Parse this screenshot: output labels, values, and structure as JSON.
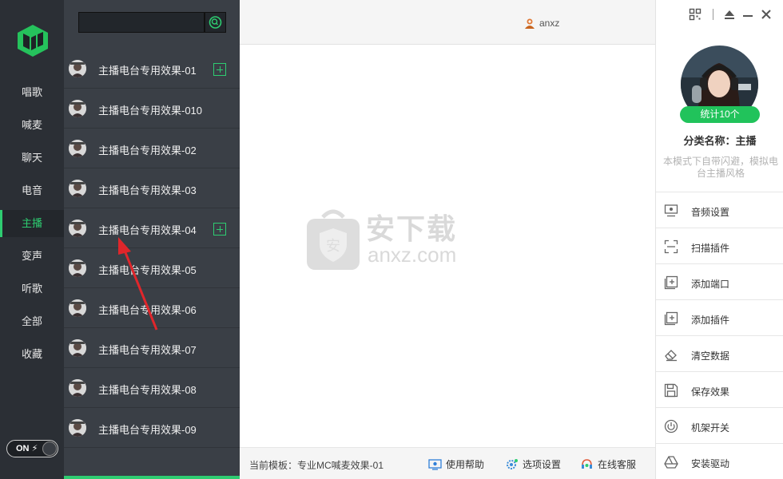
{
  "nav": {
    "items": [
      {
        "label": "唱歌",
        "active": false
      },
      {
        "label": "喊麦",
        "active": false
      },
      {
        "label": "聊天",
        "active": false
      },
      {
        "label": "电音",
        "active": false
      },
      {
        "label": "主播",
        "active": true
      },
      {
        "label": "变声",
        "active": false
      },
      {
        "label": "听歌",
        "active": false
      },
      {
        "label": "全部",
        "active": false
      },
      {
        "label": "收藏",
        "active": false
      }
    ],
    "toggle_label": "ON",
    "accent_color": "#2ecc71"
  },
  "search": {
    "value": "",
    "placeholder": ""
  },
  "list": {
    "items": [
      {
        "label": "主播电台专用效果-01",
        "has_add": true
      },
      {
        "label": "主播电台专用效果-010",
        "has_add": false
      },
      {
        "label": "主播电台专用效果-02",
        "has_add": false
      },
      {
        "label": "主播电台专用效果-03",
        "has_add": false
      },
      {
        "label": "主播电台专用效果-04",
        "has_add": true
      },
      {
        "label": "主播电台专用效果-05",
        "has_add": false
      },
      {
        "label": "主播电台专用效果-06",
        "has_add": false
      },
      {
        "label": "主播电台专用效果-07",
        "has_add": false
      },
      {
        "label": "主播电台专用效果-08",
        "has_add": false
      },
      {
        "label": "主播电台专用效果-09",
        "has_add": false
      }
    ]
  },
  "header": {
    "username": "anxz"
  },
  "watermark": {
    "cn": "安下载",
    "en": "anxz.com"
  },
  "footer": {
    "template": "当前模板：专业MC喊麦效果-01",
    "help": "使用帮助",
    "options": "选项设置",
    "support": "在线客服"
  },
  "profile": {
    "stat": "统计10个",
    "category": "分类名称：主播",
    "description": "本模式下自带闪避，模拟电台主播风格"
  },
  "menu": [
    {
      "label": "音频设置",
      "icon": "monitor-icon"
    },
    {
      "label": "扫描插件",
      "icon": "scan-icon"
    },
    {
      "label": "添加端口",
      "icon": "add-port-icon"
    },
    {
      "label": "添加插件",
      "icon": "add-plugin-icon"
    },
    {
      "label": "清空数据",
      "icon": "eraser-icon"
    },
    {
      "label": "保存效果",
      "icon": "save-icon"
    },
    {
      "label": "机架开关",
      "icon": "power-icon"
    },
    {
      "label": "安装驱动",
      "icon": "drive-icon"
    }
  ]
}
